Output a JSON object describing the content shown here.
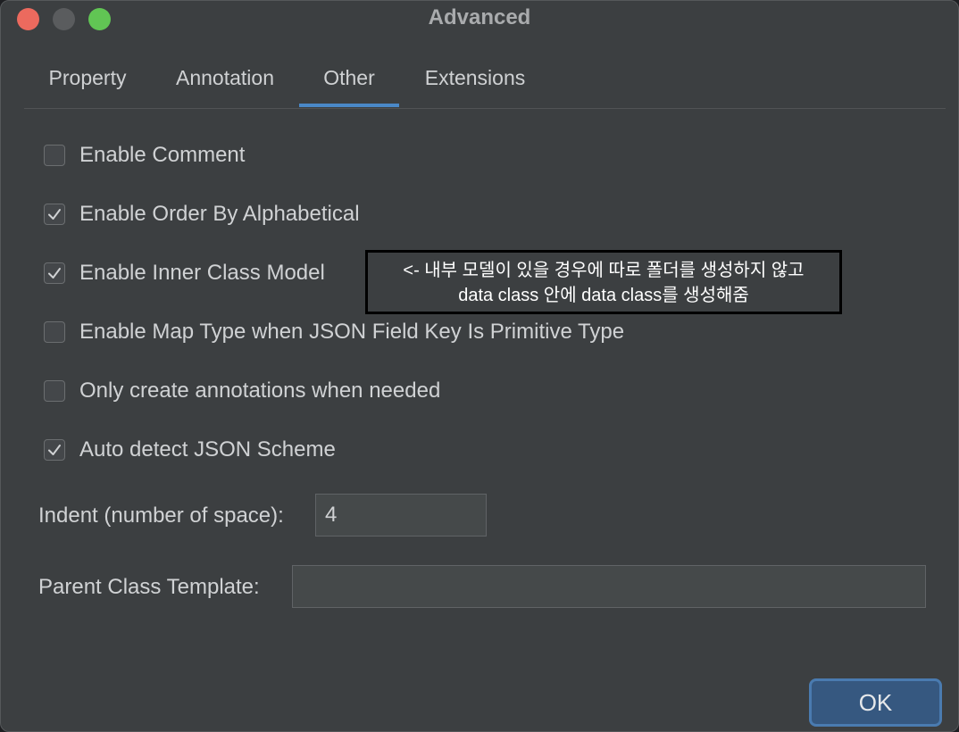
{
  "window": {
    "title": "Advanced"
  },
  "tabs": [
    {
      "label": "Property",
      "active": false
    },
    {
      "label": "Annotation",
      "active": false
    },
    {
      "label": "Other",
      "active": true
    },
    {
      "label": "Extensions",
      "active": false
    }
  ],
  "options": [
    {
      "label": "Enable Comment",
      "checked": false
    },
    {
      "label": "Enable Order By Alphabetical",
      "checked": true
    },
    {
      "label": "Enable Inner Class Model",
      "checked": true
    },
    {
      "label": "Enable Map Type when JSON Field Key Is Primitive Type",
      "checked": false
    },
    {
      "label": "Only create annotations when needed",
      "checked": false
    },
    {
      "label": "Auto detect JSON Scheme",
      "checked": true
    }
  ],
  "callout": {
    "line1": "<- 내부 모델이 있을 경우에 따로 폴더를 생성하지 않고",
    "line2": "data class 안에 data class를 생성해줌"
  },
  "indent": {
    "label": "Indent (number of space):",
    "value": "4"
  },
  "parent_class": {
    "label": "Parent Class Template:",
    "value": ""
  },
  "buttons": {
    "ok_label": "OK"
  },
  "colors": {
    "accent": "#4a88c7",
    "background": "#3c3f41",
    "close": "#ec6a5e",
    "maximize": "#61c554"
  }
}
